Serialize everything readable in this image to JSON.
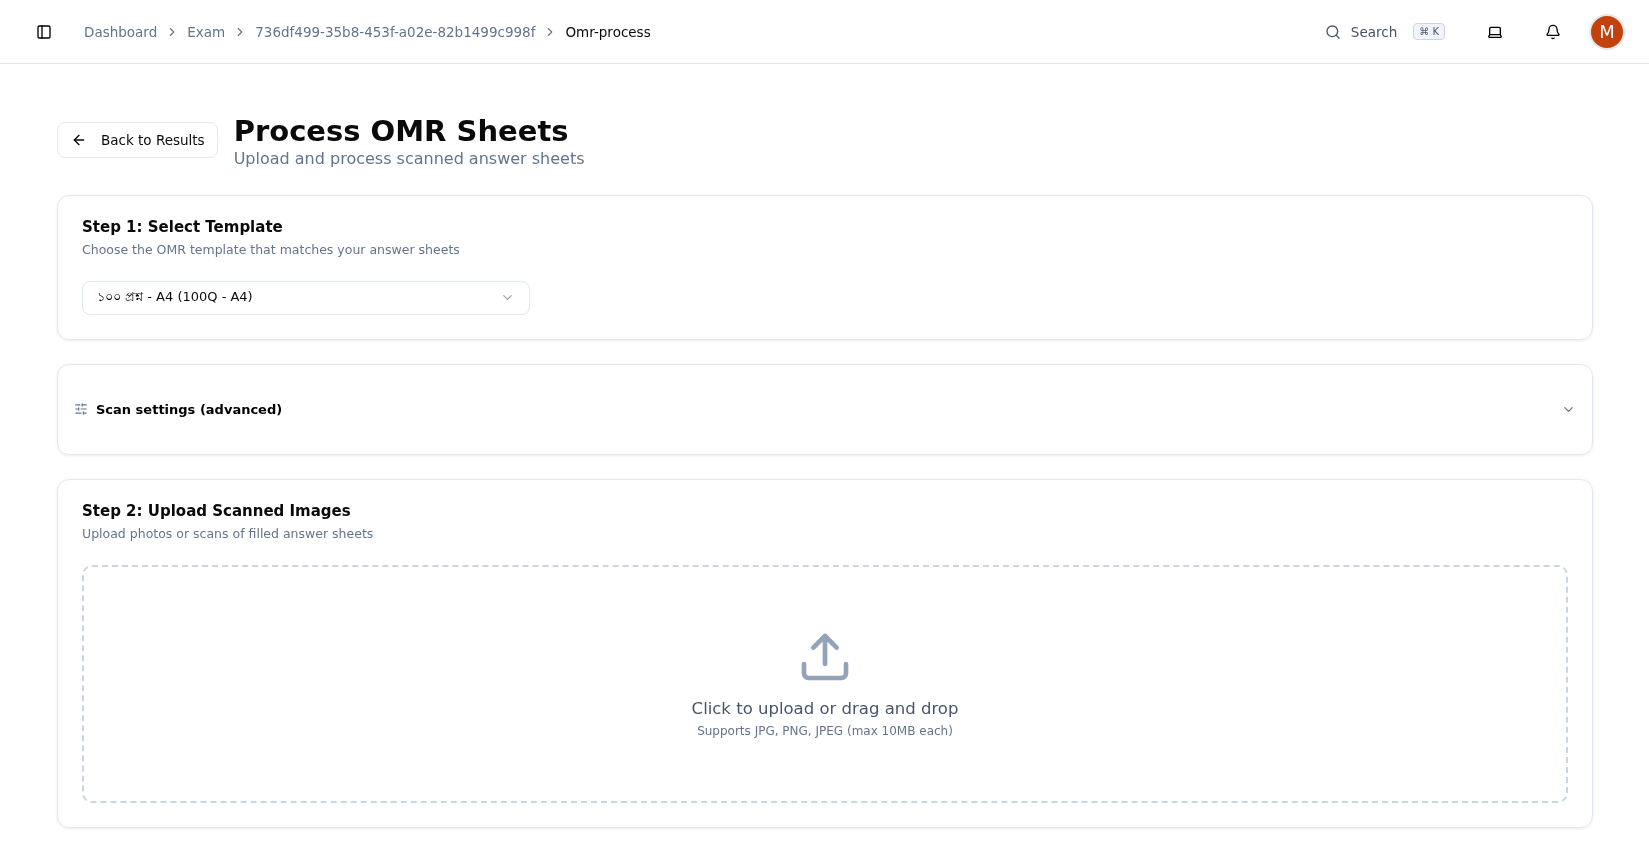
{
  "breadcrumbs": [
    {
      "label": "Dashboard",
      "current": false
    },
    {
      "label": "Exam",
      "current": false
    },
    {
      "label": "736df499-35b8-453f-a02e-82b1499c998f",
      "current": false
    },
    {
      "label": "Omr-process",
      "current": true
    }
  ],
  "search": {
    "label": "Search",
    "shortcut": "⌘ K"
  },
  "avatar": {
    "initial": "M"
  },
  "back_button": {
    "label": "Back to Results"
  },
  "page": {
    "title": "Process OMR Sheets",
    "subtitle": "Upload and process scanned answer sheets"
  },
  "step1": {
    "title": "Step 1: Select Template",
    "description": "Choose the OMR template that matches your answer sheets",
    "select_value": "১০০ প্রশ্ন - A4 (100Q - A4)"
  },
  "scan_settings": {
    "label": "Scan settings (advanced)",
    "expanded": false
  },
  "step2": {
    "title": "Step 2: Upload Scanned Images",
    "description": "Upload photos or scans of filled answer sheets",
    "dropzone": {
      "title": "Click to upload or drag and drop",
      "hint": "Supports JPG, PNG, JPEG (max 10MB each)"
    }
  }
}
